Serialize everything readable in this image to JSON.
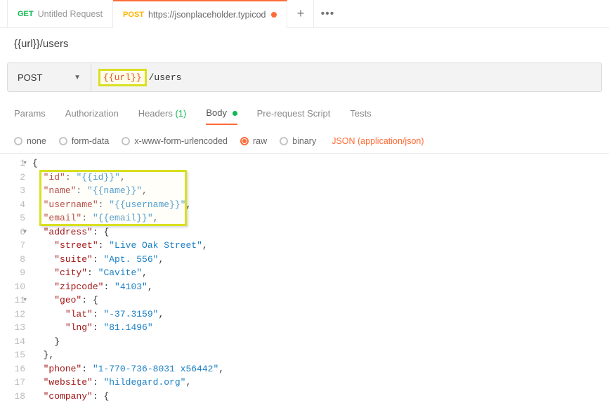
{
  "tabs": [
    {
      "method": "GET",
      "title": "Untitled Request",
      "untitled": true,
      "modified": false
    },
    {
      "method": "POST",
      "title": "https://jsonplaceholder.typicod",
      "untitled": false,
      "modified": true
    }
  ],
  "tab_actions": {
    "new": "+",
    "more": "•••"
  },
  "request_name": "{{url}}/users",
  "method_sel": "POST",
  "url_var": "{{url}}",
  "url_rest": "/users",
  "subtabs": {
    "params": "Params",
    "authorization": "Authorization",
    "headers": "Headers",
    "headers_count": "(1)",
    "body": "Body",
    "prerequest": "Pre-request Script",
    "tests": "Tests"
  },
  "body_types": {
    "none": "none",
    "formdata": "form-data",
    "urlencoded": "x-www-form-urlencoded",
    "raw": "raw",
    "binary": "binary",
    "content_type": "JSON (application/json)"
  },
  "editor": {
    "lines": [
      [
        0,
        "{"
      ],
      [
        1,
        "K:\"id\"",
        ": ",
        "S:\"{{id}}\"",
        ","
      ],
      [
        1,
        "K:\"name\"",
        ": ",
        "S:\"{{name}}\"",
        ","
      ],
      [
        1,
        "K:\"username\"",
        ": ",
        "S:\"{{username}}\"",
        ","
      ],
      [
        1,
        "K:\"email\"",
        ": ",
        "S:\"{{email}}\"",
        ","
      ],
      [
        1,
        "K:\"address\"",
        ": ",
        "{"
      ],
      [
        2,
        "K:\"street\"",
        ": ",
        "S:\"Live Oak Street\"",
        ","
      ],
      [
        2,
        "K:\"suite\"",
        ": ",
        "S:\"Apt. 556\"",
        ","
      ],
      [
        2,
        "K:\"city\"",
        ": ",
        "S:\"Cavite\"",
        ","
      ],
      [
        2,
        "K:\"zipcode\"",
        ": ",
        "S:\"4103\"",
        ","
      ],
      [
        2,
        "K:\"geo\"",
        ": ",
        "{"
      ],
      [
        3,
        "K:\"lat\"",
        ": ",
        "S:\"-37.3159\"",
        ","
      ],
      [
        3,
        "K:\"lng\"",
        ": ",
        "S:\"81.1496\""
      ],
      [
        2,
        "}"
      ],
      [
        1,
        "},"
      ],
      [
        1,
        "K:\"phone\"",
        ": ",
        "S:\"1-770-736-8031 x56442\"",
        ","
      ],
      [
        1,
        "K:\"website\"",
        ": ",
        "S:\"hildegard.org\"",
        ","
      ],
      [
        1,
        "K:\"company\"",
        ": ",
        "{"
      ]
    ],
    "fold_lines": [
      1,
      6,
      11
    ]
  }
}
